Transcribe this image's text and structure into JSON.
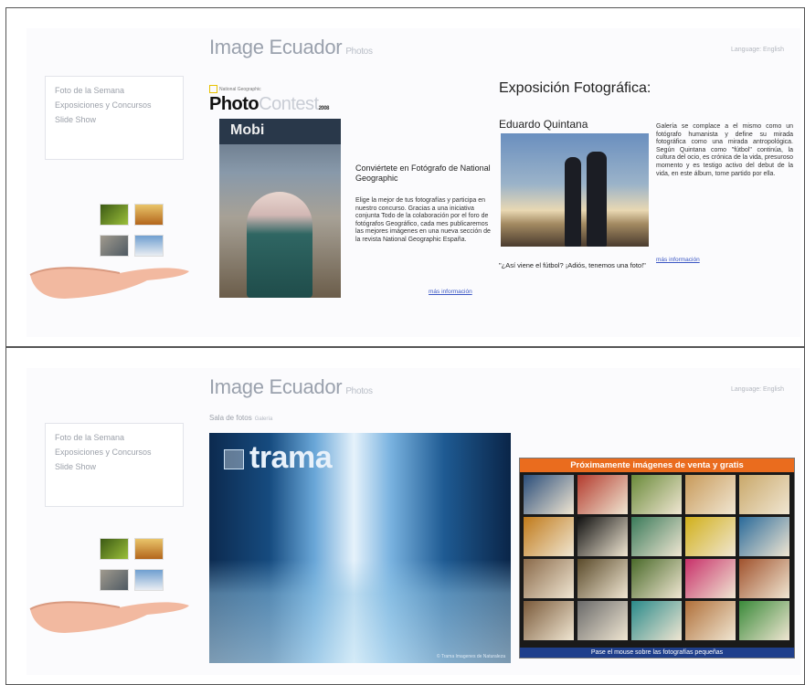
{
  "site": {
    "brand": "Image Ecuador",
    "brand_sub": "Photos",
    "top_link": "Language: English"
  },
  "nav": {
    "items": [
      "Foto de la Semana",
      "Exposiciones y Concursos",
      "Slide Show"
    ]
  },
  "top_panel": {
    "ng_badge": "National Geographic",
    "photo_logo_main": "Photo",
    "photo_logo_contest": "Contest",
    "photo_logo_year": "2008",
    "photo_contest_heading": "Conviértete en Fotógrafo de National Geographic",
    "photo_contest_body": "Elige la mejor de tus fotografías y participa en nuestro concurso. Gracias a una iniciativa conjunta Todo de la colaboración por el foro de fotógrafos Geográfico, cada mes publicaremos las mejores imágenes en una nueva sección de la revista National Geographic España.",
    "photo_contest_more": "más información",
    "expo_title": "Exposición Fotográfica:",
    "expo_author": "Eduardo Quintana",
    "expo_caption": "\"¿Así viene el fútbol? ¡Adiós, tenemos una foto!\"",
    "expo_body": "Galería se complace a el mismo como un fotógrafo humanista y define su mirada fotográfica como una mirada antropológica. Según Quintana como \"fútbol\" continúa, la cultura del ocio, es crónica de la vida, presuroso momento y es testigo activo del debut de la vida, en este álbum, tome partido por ella.",
    "expo_more": "más información"
  },
  "bottom_panel": {
    "gallery_title": "Sala de fotos",
    "gallery_sub": "Galería",
    "trama_logo": "trama",
    "waterfall_credit": "© Trama Imagenes de Naturaleza",
    "grid_header": "Próximamente imágenes de venta y gratis",
    "grid_footer": "Pase el mouse sobre las fotografías pequeñas"
  },
  "colors": {
    "brand_gray": "#9aa1ad",
    "link_blue": "#3b57c4",
    "grid_header_orange": "#ea6c1e",
    "grid_footer_blue": "#1f3f8c"
  }
}
